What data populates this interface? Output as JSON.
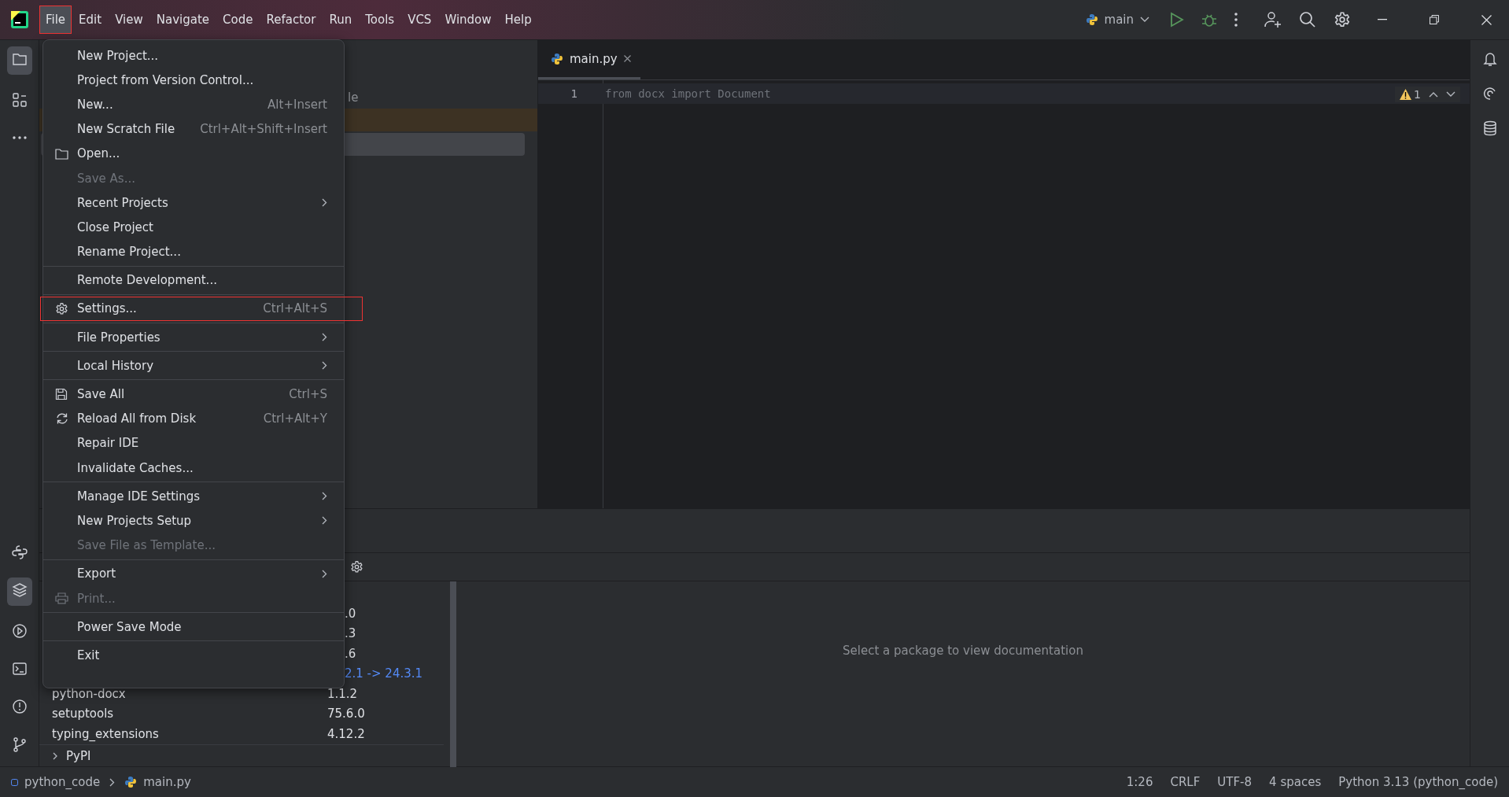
{
  "menu_bar": [
    {
      "label": "File",
      "selected": true,
      "annotated": true
    },
    {
      "label": "Edit",
      "selected": false,
      "annotated": false
    },
    {
      "label": "View",
      "selected": false,
      "annotated": false
    },
    {
      "label": "Navigate",
      "selected": false,
      "annotated": false
    },
    {
      "label": "Code",
      "selected": false,
      "annotated": false
    },
    {
      "label": "Refactor",
      "selected": false,
      "annotated": false
    },
    {
      "label": "Run",
      "selected": false,
      "annotated": false
    },
    {
      "label": "Tools",
      "selected": false,
      "annotated": false
    },
    {
      "label": "VCS",
      "selected": false,
      "annotated": false
    },
    {
      "label": "Window",
      "selected": false,
      "annotated": false
    },
    {
      "label": "Help",
      "selected": false,
      "annotated": false
    }
  ],
  "run_config": {
    "label": "main"
  },
  "file_menu": [
    {
      "kind": "text",
      "label": "New Project...",
      "disabled": false,
      "submenu": false,
      "annotated": false
    },
    {
      "kind": "text",
      "label": "Project from Version Control...",
      "disabled": false,
      "submenu": false,
      "annotated": false
    },
    {
      "kind": "text",
      "label": "New...",
      "shortcut": "Alt+Insert",
      "disabled": false,
      "submenu": false,
      "annotated": false
    },
    {
      "kind": "text",
      "label": "New Scratch File",
      "shortcut": "Ctrl+Alt+Shift+Insert",
      "disabled": false,
      "submenu": false,
      "annotated": false
    },
    {
      "kind": "folder",
      "label": "Open...",
      "disabled": false,
      "submenu": false,
      "annotated": false
    },
    {
      "kind": "text",
      "label": "Save As...",
      "disabled": true,
      "submenu": false,
      "annotated": false
    },
    {
      "kind": "text",
      "label": "Recent Projects",
      "disabled": false,
      "submenu": true,
      "annotated": false
    },
    {
      "kind": "text",
      "label": "Close Project",
      "disabled": false,
      "submenu": false,
      "annotated": false
    },
    {
      "kind": "text",
      "label": "Rename Project...",
      "disabled": false,
      "submenu": false,
      "annotated": false
    },
    {
      "kind": "separator"
    },
    {
      "kind": "text",
      "label": "Remote Development...",
      "disabled": false,
      "submenu": false,
      "annotated": false
    },
    {
      "kind": "separator"
    },
    {
      "kind": "gear",
      "label": "Settings...",
      "shortcut": "Ctrl+Alt+S",
      "disabled": false,
      "submenu": false,
      "annotated": true
    },
    {
      "kind": "separator"
    },
    {
      "kind": "text",
      "label": "File Properties",
      "disabled": false,
      "submenu": true,
      "annotated": false
    },
    {
      "kind": "separator"
    },
    {
      "kind": "text",
      "label": "Local History",
      "disabled": false,
      "submenu": true,
      "annotated": false
    },
    {
      "kind": "separator"
    },
    {
      "kind": "save",
      "label": "Save All",
      "shortcut": "Ctrl+S",
      "disabled": false,
      "submenu": false,
      "annotated": false
    },
    {
      "kind": "reload",
      "label": "Reload All from Disk",
      "shortcut": "Ctrl+Alt+Y",
      "disabled": false,
      "submenu": false,
      "annotated": false
    },
    {
      "kind": "text",
      "label": "Repair IDE",
      "disabled": false,
      "submenu": false,
      "annotated": false
    },
    {
      "kind": "text",
      "label": "Invalidate Caches...",
      "disabled": false,
      "submenu": false,
      "annotated": false
    },
    {
      "kind": "separator"
    },
    {
      "kind": "text",
      "label": "Manage IDE Settings",
      "disabled": false,
      "submenu": true,
      "annotated": false
    },
    {
      "kind": "text",
      "label": "New Projects Setup",
      "disabled": false,
      "submenu": true,
      "annotated": false
    },
    {
      "kind": "text",
      "label": "Save File as Template...",
      "disabled": true,
      "submenu": false,
      "annotated": false
    },
    {
      "kind": "separator"
    },
    {
      "kind": "text",
      "label": "Export",
      "disabled": false,
      "submenu": true,
      "annotated": false
    },
    {
      "kind": "printer",
      "label": "Print...",
      "disabled": true,
      "submenu": false,
      "annotated": false
    },
    {
      "kind": "separator"
    },
    {
      "kind": "text",
      "label": "Power Save Mode",
      "disabled": false,
      "submenu": false,
      "annotated": false
    },
    {
      "kind": "separator"
    },
    {
      "kind": "text",
      "label": "Exit",
      "disabled": false,
      "submenu": false,
      "annotated": false
    }
  ],
  "project_panel": {
    "partial_text": "le"
  },
  "editor": {
    "tab": {
      "label": "main.py",
      "selected": true
    },
    "lines": [
      {
        "number": "1",
        "code": "from docx import Document"
      }
    ],
    "warning_count": "1"
  },
  "packages": {
    "rows": [
      {
        "version": ".0",
        "upgrade": false
      },
      {
        "version": ".3",
        "upgrade": false
      },
      {
        "version": ".6",
        "upgrade": false
      },
      {
        "version": "2.1 -> 24.3.1",
        "upgrade": true
      },
      {
        "name": "python-docx",
        "version": "1.1.2",
        "upgrade": false
      },
      {
        "name": "setuptools",
        "version": "75.6.0",
        "upgrade": false
      },
      {
        "name": "typing_extensions",
        "version": "4.12.2",
        "upgrade": false
      }
    ],
    "group": {
      "label": "PyPI",
      "expanded": false
    },
    "documentation_hint": "Select a package to view documentation"
  },
  "status_bar": {
    "breadcrumbs": [
      "python_code",
      "main.py"
    ],
    "position": "1:26",
    "line_separator": "CRLF",
    "encoding": "UTF-8",
    "indent": "4 spaces",
    "interpreter": "Python 3.13 (python_code)"
  }
}
